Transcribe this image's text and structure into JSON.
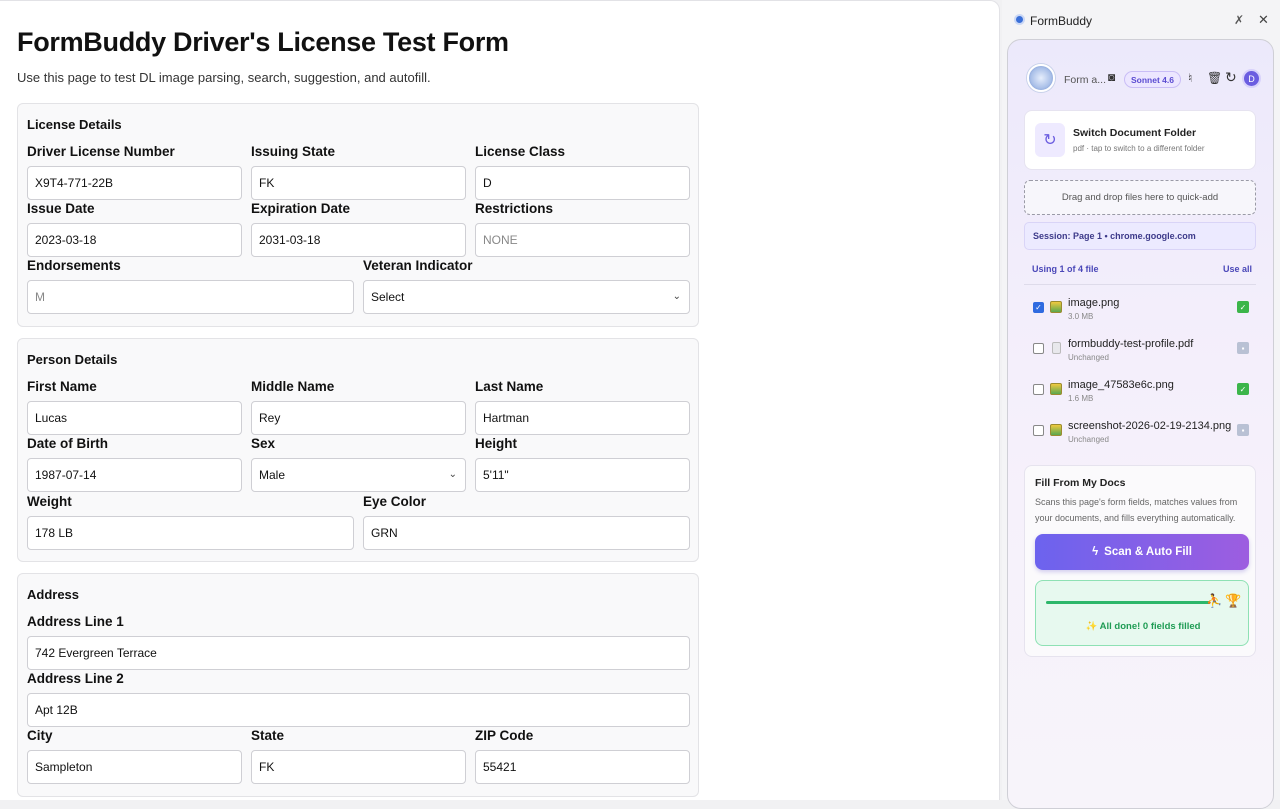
{
  "page": {
    "title": "FormBuddy Driver's License Test Form",
    "subtitle": "Use this page to test DL image parsing, search, suggestion, and autofill."
  },
  "license": {
    "section_title": "License Details",
    "dl_number": {
      "label": "Driver License Number",
      "value": "X9T4-771-22B"
    },
    "issuing_state": {
      "label": "Issuing State",
      "value": "FK"
    },
    "license_class": {
      "label": "License Class",
      "value": "D"
    },
    "issue_date": {
      "label": "Issue Date",
      "value": "2023-03-18"
    },
    "expiration_date": {
      "label": "Expiration Date",
      "value": "2031-03-18"
    },
    "restrictions": {
      "label": "Restrictions",
      "placeholder": "NONE"
    },
    "endorsements": {
      "label": "Endorsements",
      "placeholder": "M"
    },
    "veteran": {
      "label": "Veteran Indicator",
      "value": "Select"
    }
  },
  "person": {
    "section_title": "Person Details",
    "first_name": {
      "label": "First Name",
      "value": "Lucas"
    },
    "middle_name": {
      "label": "Middle Name",
      "value": "Rey"
    },
    "last_name": {
      "label": "Last Name",
      "value": "Hartman"
    },
    "dob": {
      "label": "Date of Birth",
      "value": "1987-07-14"
    },
    "sex": {
      "label": "Sex",
      "value": "Male"
    },
    "height": {
      "label": "Height",
      "value": "5'11\""
    },
    "weight": {
      "label": "Weight",
      "value": "178 LB"
    },
    "eye_color": {
      "label": "Eye Color",
      "value": "GRN"
    }
  },
  "address": {
    "section_title": "Address",
    "line1": {
      "label": "Address Line 1",
      "value": "742 Evergreen Terrace"
    },
    "line2": {
      "label": "Address Line 2",
      "value": "Apt 12B"
    },
    "city": {
      "label": "City",
      "value": "Sampleton"
    },
    "state": {
      "label": "State",
      "value": "FK"
    },
    "zip": {
      "label": "ZIP Code",
      "value": "55421"
    }
  },
  "sidepanel": {
    "app_name": "FormBuddy",
    "form_tag": "Form a...",
    "model": "Sonnet 4.6",
    "profile_initial": "D",
    "switch_title": "Switch Document Folder",
    "switch_sub": "pdf · tap to switch to a different folder",
    "drop_text": "Drag and drop files here to quick-add",
    "session": "Session: Page 1 • chrome.google.com",
    "using": "Using 1 of 4 file",
    "use_all": "Use all",
    "files": [
      {
        "name": "image.png",
        "meta": "3.0 MB",
        "checked": true,
        "status": "ok"
      },
      {
        "name": "formbuddy-test-profile.pdf",
        "meta": "Unchanged",
        "checked": false,
        "status": "un"
      },
      {
        "name": "image_47583e6c.png",
        "meta": "1.6 MB",
        "checked": false,
        "status": "ok"
      },
      {
        "name": "screenshot-2026-02-19-2134.png",
        "meta": "Unchanged",
        "checked": false,
        "status": "un"
      }
    ],
    "fill_title": "Fill From My Docs",
    "fill_desc": "Scans this page's form fields, matches values from your documents, and fills everything automatically.",
    "scan_label": "Scan & Auto Fill",
    "progress": 1.0,
    "done_text": "✨ All done! 0 fields filled"
  },
  "colors": {
    "accent": "#6c63ee",
    "success": "#2db76a",
    "session_text": "#3d3a8a"
  },
  "icons": [
    "pin-icon",
    "close-icon",
    "camera-icon",
    "mic-icon",
    "trash-icon",
    "refresh-icon",
    "switch-folder-icon",
    "lightning-icon",
    "runner-icon",
    "trophy-icon",
    "checkmark-icon",
    "chevron-down-icon"
  ]
}
